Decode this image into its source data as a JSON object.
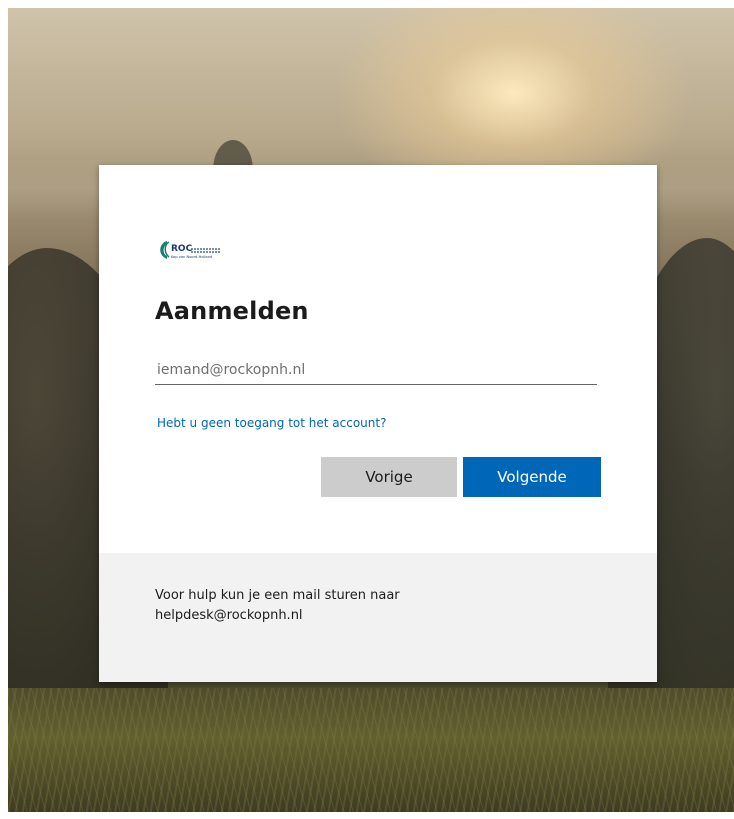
{
  "brand": {
    "logo_text": "ROC",
    "logo_subtext": "Kop van Noord-Holland",
    "accent": "#0067b8",
    "logo_color": "#1a7f6e"
  },
  "signin": {
    "title": "Aanmelden",
    "email_placeholder": "iemand@rockopnh.nl",
    "email_value": "",
    "no_access_link": "Hebt u geen toegang tot het account?",
    "back_button": "Vorige",
    "next_button": "Volgende"
  },
  "footer": {
    "help_line1": "Voor hulp kun je een mail sturen naar",
    "help_line2": "helpdesk@rockopnh.nl"
  }
}
